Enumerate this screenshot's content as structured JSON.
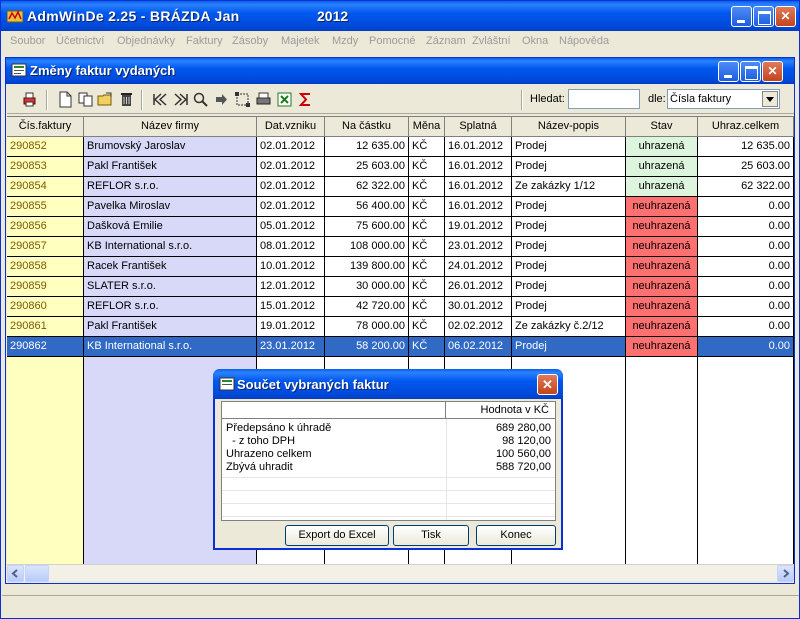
{
  "app": {
    "title": "AdmWinDe 2.25 - BRÁZDA Jan",
    "year": "2012"
  },
  "menu": [
    "Soubor",
    "Účetnictví",
    "Objednávky",
    "Faktury",
    "Zásoby",
    "Majetek",
    "Mzdy",
    "Pomocné",
    "Záznam",
    "Zvláštní",
    "Okna",
    "Nápověda"
  ],
  "child_window": {
    "title": "Změny faktur vydaných"
  },
  "toolbar": {
    "search_label": "Hledat:",
    "search_value": "",
    "by_label": "dle:",
    "by_value": "Čísla faktury",
    "icons": [
      "print-icon",
      "new-document-icon",
      "copy-icon",
      "open-folder-icon",
      "delete-icon",
      "first-record-icon",
      "last-record-icon",
      "find-icon",
      "next-icon",
      "select-icon",
      "print-list-icon",
      "excel-export-icon",
      "sum-icon"
    ]
  },
  "table": {
    "columns": [
      "Čís.faktury",
      "Název firmy",
      "Dat.vzniku",
      "Na částku",
      "Měna",
      "Splatná",
      "Název-popis",
      "Stav",
      "Uhraz.celkem"
    ],
    "rows": [
      [
        "290852",
        "Brumovský Jaroslav",
        "02.01.2012",
        "12 635.00",
        "KČ",
        "16.01.2012",
        "Prodej",
        "uhrazená",
        "12 635.00"
      ],
      [
        "290853",
        "Pakl František",
        "02.01.2012",
        "25 603.00",
        "KČ",
        "16.01.2012",
        "Prodej",
        "uhrazená",
        "25 603.00"
      ],
      [
        "290854",
        "REFLOR s.r.o.",
        "02.01.2012",
        "62 322.00",
        "KČ",
        "16.01.2012",
        "Ze zakázky 1/12",
        "uhrazená",
        "62 322.00"
      ],
      [
        "290855",
        "Pavelka Miroslav",
        "02.01.2012",
        "56 400.00",
        "KČ",
        "16.01.2012",
        "Prodej",
        "neuhrazená",
        "0.00"
      ],
      [
        "290856",
        "Dašková Emilie",
        "05.01.2012",
        "75 600.00",
        "KČ",
        "19.01.2012",
        "Prodej",
        "neuhrazená",
        "0.00"
      ],
      [
        "290857",
        "KB International s.r.o.",
        "08.01.2012",
        "108 000.00",
        "KČ",
        "23.01.2012",
        "Prodej",
        "neuhrazená",
        "0.00"
      ],
      [
        "290858",
        "Racek František",
        "10.01.2012",
        "139 800.00",
        "KČ",
        "24.01.2012",
        "Prodej",
        "neuhrazená",
        "0.00"
      ],
      [
        "290859",
        "SLATER s.r.o.",
        "12.01.2012",
        "30 000.00",
        "KČ",
        "26.01.2012",
        "Prodej",
        "neuhrazená",
        "0.00"
      ],
      [
        "290860",
        "REFLOR s.r.o.",
        "15.01.2012",
        "42 720.00",
        "KČ",
        "30.01.2012",
        "Prodej",
        "neuhrazená",
        "0.00"
      ],
      [
        "290861",
        "Pakl František",
        "19.01.2012",
        "78 000.00",
        "KČ",
        "02.02.2012",
        "Ze zakázky č.2/12",
        "neuhrazená",
        "0.00"
      ],
      [
        "290862",
        "KB International s.r.o.",
        "23.01.2012",
        "58 200.00",
        "KČ",
        "06.02.2012",
        "Prodej",
        "neuhrazená",
        "0.00"
      ]
    ],
    "selected_row": 10
  },
  "dialog": {
    "title": "Součet vybraných faktur",
    "value_header": "Hodnota v KČ",
    "rows": [
      {
        "label": "Předepsáno k úhradě",
        "value": "689 280,00"
      },
      {
        "label": "  - z toho DPH",
        "value": "98 120,00"
      },
      {
        "label": "Uhrazeno celkem",
        "value": "100 560,00"
      },
      {
        "label": "Zbývá uhradit",
        "value": "588 720,00"
      }
    ],
    "buttons": {
      "export": "Export do Excel",
      "print": "Tisk",
      "close": "Konec"
    }
  },
  "colors": {
    "titlebar": "#0058ee",
    "paid": "#ddf5dd",
    "unpaid": "#ff7070",
    "selection": "#316ac5",
    "invoice_col": "#ffffc0",
    "name_col": "#d8d8f8"
  }
}
